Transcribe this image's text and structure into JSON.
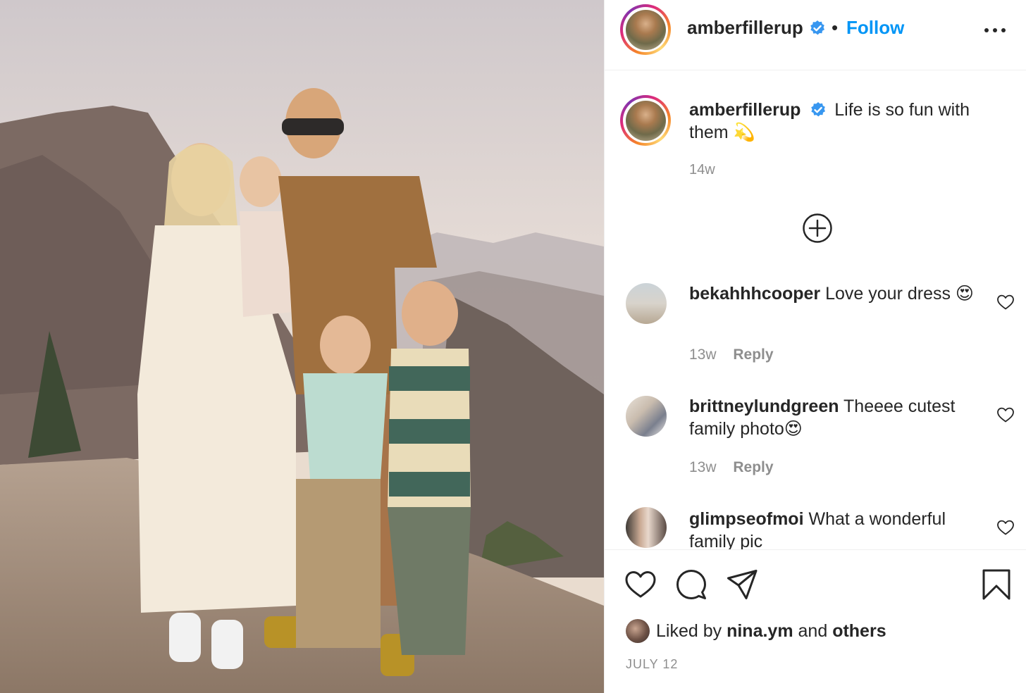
{
  "post": {
    "username": "amberfillerup",
    "verified": true,
    "separator": "•",
    "follow_label": "Follow",
    "more_icon": "more-horizontal-icon",
    "caption": {
      "username": "amberfillerup",
      "text": "Life is so fun with them 💫",
      "time": "14w"
    },
    "load_more_icon": "plus-circle-icon",
    "comments": [
      {
        "username": "bekahhhcooper",
        "text": "Love your dress 😍",
        "time": "13w",
        "reply_label": "Reply"
      },
      {
        "username": "brittneylundgreen",
        "text": "Theeee cutest family photo😍",
        "time": "13w",
        "reply_label": "Reply"
      },
      {
        "username": "glimpseofmoi",
        "text": "What a wonderful family pic",
        "time": "",
        "reply_label": ""
      }
    ],
    "likes": {
      "prefix": "Liked by",
      "user": "nina.ym",
      "middle": "and",
      "suffix": "others"
    },
    "date": "JULY 12"
  },
  "colors": {
    "accent": "#0095f6",
    "verified_badge": "#3897f0",
    "text_primary": "#262626",
    "text_secondary": "#8e8e8e",
    "border": "#efefef"
  }
}
